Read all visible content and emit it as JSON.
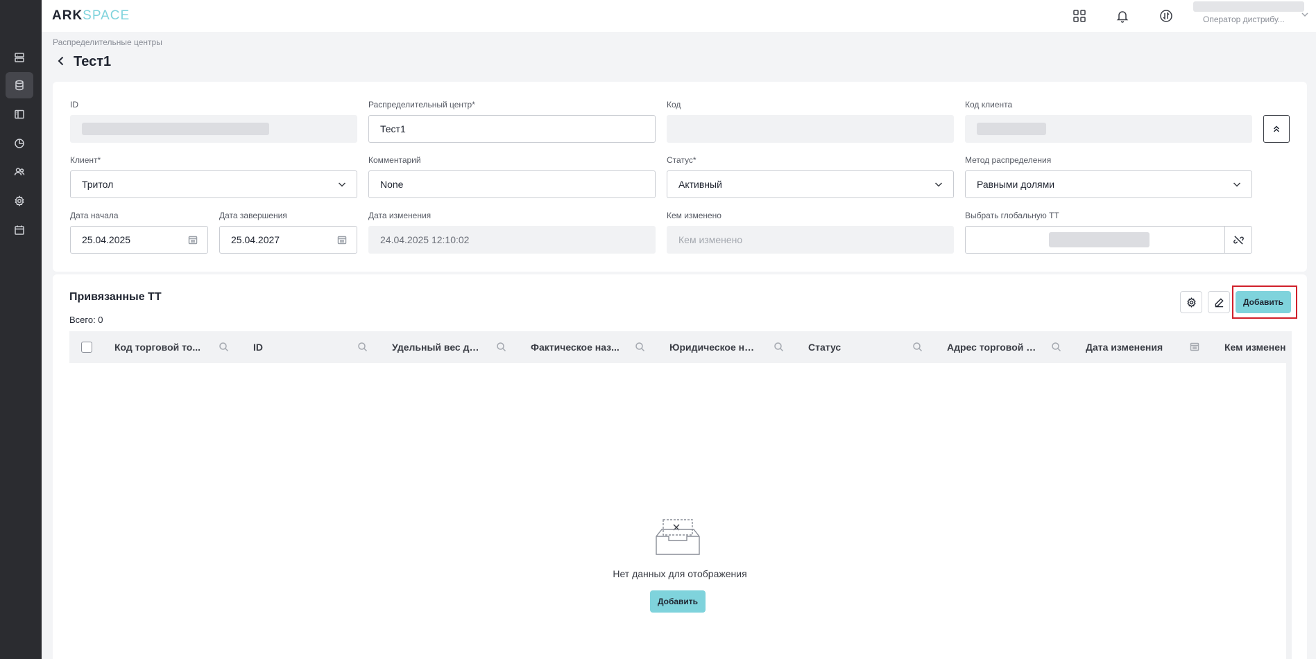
{
  "app": {
    "logo_main": "ARK",
    "logo_accent": "SPACE"
  },
  "topbar": {
    "icons": [
      "apps-grid-icon",
      "bell-icon",
      "sync-icon"
    ],
    "user_role": "Оператор дистрибу..."
  },
  "sidebar": {
    "items": [
      "server-icon",
      "database-icon",
      "layout-icon",
      "chart-icon",
      "users-icon",
      "settings-icon",
      "calendar-icon"
    ],
    "active": "database-icon"
  },
  "breadcrumb": "Распределительные центры",
  "page_title": "Тест1",
  "form": {
    "id": {
      "label": "ID"
    },
    "dc": {
      "label": "Распределительный центр*",
      "value": "Тест1"
    },
    "code": {
      "label": "Код",
      "value": ""
    },
    "client_code": {
      "label": "Код клиента"
    },
    "client": {
      "label": "Клиент*",
      "value": "Тритол"
    },
    "comment": {
      "label": "Комментарий",
      "value": "None"
    },
    "status": {
      "label": "Статус*",
      "value": "Активный"
    },
    "method": {
      "label": "Метод распределения",
      "value": "Равными долями"
    },
    "start_date": {
      "label": "Дата начала",
      "value": "25.04.2025"
    },
    "end_date": {
      "label": "Дата завершения",
      "value": "25.04.2027"
    },
    "changed_at": {
      "label": "Дата изменения",
      "value": "24.04.2025 12:10:02"
    },
    "changed_by": {
      "label": "Кем изменено",
      "placeholder": "Кем изменено"
    },
    "global_tt": {
      "label": "Выбрать глобальную ТТ"
    }
  },
  "section": {
    "title": "Привязанные ТТ",
    "total": "Всего: 0",
    "add_label": "Добавить"
  },
  "table": {
    "columns": [
      "Код торговой то...",
      "ID",
      "Удельный вес дис...",
      "Фактическое наз...",
      "Юридическое наз...",
      "Статус",
      "Адрес торговой т...",
      "Дата изменения",
      "Кем изменен"
    ],
    "rows": []
  },
  "empty": {
    "text": "Нет данных для отображения",
    "add_label": "Добавить"
  }
}
